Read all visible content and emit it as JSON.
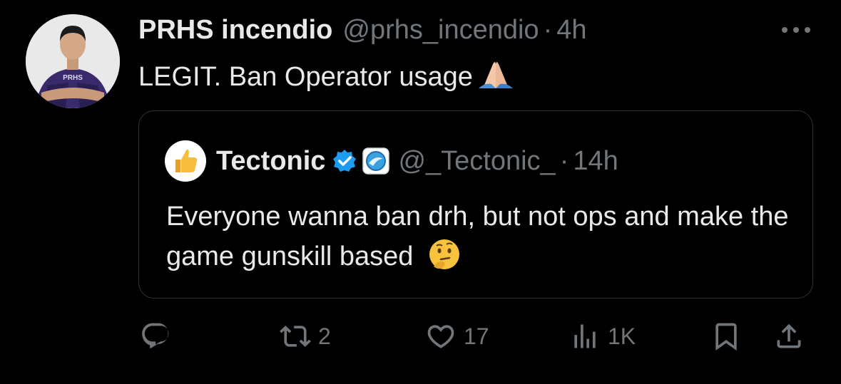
{
  "tweet": {
    "author_name": "PRHS incendio",
    "handle": "@prhs_incendio",
    "separator": "·",
    "time": "4h",
    "text": "LEGIT. Ban Operator usage",
    "avatar_jersey_text": "PRHS",
    "text_emoji": "folded-hands-emoji",
    "more_icon": "more-horizontal-icon"
  },
  "quote": {
    "author_name": "Tectonic",
    "handle": "@_Tectonic_",
    "separator": "·",
    "time": "14h",
    "text": "Everyone wanna ban drh, but not ops and make the game gunskill based",
    "text_emoji": "thinking-face-emoji",
    "avatar_icon": "thumbs-up-icon",
    "verified_icon": "verified-badge-icon",
    "affiliate_icon": "team-logo-icon"
  },
  "actions": {
    "reply": {
      "icon": "reply-icon",
      "count": ""
    },
    "repost": {
      "icon": "repost-icon",
      "count": "2"
    },
    "like": {
      "icon": "heart-icon",
      "count": "17"
    },
    "views": {
      "icon": "views-icon",
      "count": "1K"
    },
    "bookmark": {
      "icon": "bookmark-icon"
    },
    "share": {
      "icon": "share-icon"
    }
  },
  "colors": {
    "background": "#000000",
    "primary_text": "#e7e9ea",
    "secondary_text": "#71767b",
    "border": "#2f3336",
    "verified_blue": "#1d9bf0"
  }
}
